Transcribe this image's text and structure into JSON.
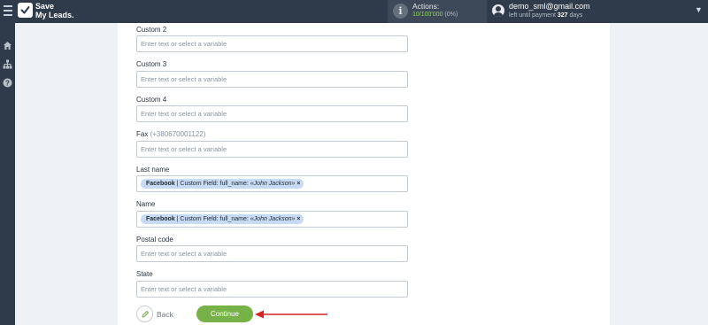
{
  "header": {
    "logo_line1": "Save",
    "logo_line2": "My Leads.",
    "actions_title": "Actions:",
    "actions_used": "10",
    "actions_total": "/100'000",
    "actions_pct": "(0%)",
    "user_email": "demo_sml@gmail.com",
    "payment_prefix": "left until payment",
    "payment_days": "327",
    "payment_suffix": "days"
  },
  "sidebar": {
    "icons": [
      "home-icon",
      "sitemap-icon",
      "help-icon"
    ]
  },
  "form": {
    "placeholder": "Enter text or select a variable",
    "fields": [
      {
        "label": "Custom 2"
      },
      {
        "label": "Custom 3"
      },
      {
        "label": "Custom 4"
      },
      {
        "label": "Fax",
        "hint": "(+380670001122)"
      },
      {
        "label": "Last name",
        "tag": {
          "source": "Facebook",
          "field": "| Custom Field: full_name:",
          "value": "«John Jackson»",
          "remove": "×"
        }
      },
      {
        "label": "Name",
        "tag": {
          "source": "Facebook",
          "field": "| Custom Field: full_name:",
          "value": "«John Jackson»",
          "remove": "×"
        }
      },
      {
        "label": "Postal code"
      },
      {
        "label": "State"
      }
    ]
  },
  "buttons": {
    "back_label": "Back",
    "continue_label": "Continue"
  },
  "colors": {
    "topbar": "#2f3b4a",
    "accent_green": "#77b248",
    "tag_bg": "#c7dbf5",
    "arrow_red": "#d62424"
  }
}
